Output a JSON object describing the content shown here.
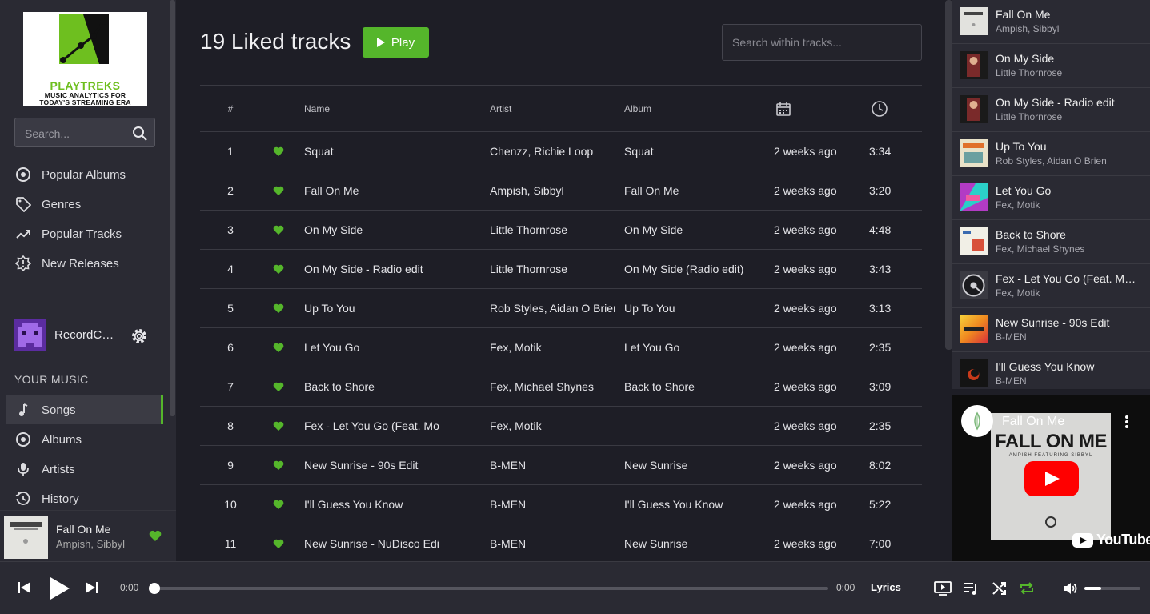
{
  "colors": {
    "accent": "#55b62b",
    "background": "#1e1e26",
    "panel": "#2a2a33",
    "youtube_red": "#ff0000"
  },
  "logo": {
    "brand": "PLAYTREKS",
    "tagline_1": "MUSIC ANALYTICS FOR",
    "tagline_2": "TODAY'S STREAMING ERA"
  },
  "sidebar": {
    "search_placeholder": "Search...",
    "browse": [
      {
        "label": "Popular Albums",
        "icon": "album-icon"
      },
      {
        "label": "Genres",
        "icon": "tag-icon"
      },
      {
        "label": "Popular Tracks",
        "icon": "trending-icon"
      },
      {
        "label": "New Releases",
        "icon": "new-releases-icon"
      }
    ],
    "profile_name": "RecordCo...",
    "section_title": "YOUR MUSIC",
    "your_music": [
      {
        "label": "Songs",
        "icon": "music-note-icon",
        "active": true
      },
      {
        "label": "Albums",
        "icon": "album-icon"
      },
      {
        "label": "Artists",
        "icon": "microphone-icon"
      },
      {
        "label": "History",
        "icon": "history-icon"
      }
    ]
  },
  "now_playing": {
    "title": "Fall On Me",
    "artist": "Ampish, Sibbyl"
  },
  "main": {
    "title": "19 Liked tracks",
    "play_label": "Play",
    "search_placeholder": "Search within tracks...",
    "columns": {
      "num": "#",
      "name": "Name",
      "artist": "Artist",
      "album": "Album",
      "date_icon": "calendar-icon",
      "duration_icon": "clock-icon"
    },
    "tracks": [
      {
        "num": "1",
        "name": "Squat",
        "artist": "Chenzz, Richie Loop",
        "album": "Squat",
        "added": "2 weeks ago",
        "duration": "3:34"
      },
      {
        "num": "2",
        "name": "Fall On Me",
        "artist": "Ampish, Sibbyl",
        "album": "Fall On Me",
        "added": "2 weeks ago",
        "duration": "3:20"
      },
      {
        "num": "3",
        "name": "On My Side",
        "artist": "Little Thornrose",
        "album": "On My Side",
        "added": "2 weeks ago",
        "duration": "4:48"
      },
      {
        "num": "4",
        "name": "On My Side - Radio edit",
        "artist": "Little Thornrose",
        "album": "On My Side (Radio edit)",
        "added": "2 weeks ago",
        "duration": "3:43"
      },
      {
        "num": "5",
        "name": "Up To You",
        "artist": "Rob Styles, Aidan O Brien",
        "album": "Up To You",
        "added": "2 weeks ago",
        "duration": "3:13"
      },
      {
        "num": "6",
        "name": "Let You Go",
        "artist": "Fex, Motik",
        "album": "Let You Go",
        "added": "2 weeks ago",
        "duration": "2:35"
      },
      {
        "num": "7",
        "name": "Back to Shore",
        "artist": "Fex, Michael Shynes",
        "album": "Back to Shore",
        "added": "2 weeks ago",
        "duration": "3:09"
      },
      {
        "num": "8",
        "name": "Fex - Let You Go (Feat. Mot",
        "artist": "Fex, Motik",
        "album": "",
        "added": "2 weeks ago",
        "duration": "2:35"
      },
      {
        "num": "9",
        "name": "New Sunrise - 90s Edit",
        "artist": "B-MEN",
        "album": "New Sunrise",
        "added": "2 weeks ago",
        "duration": "8:02"
      },
      {
        "num": "10",
        "name": "I'll Guess You Know",
        "artist": "B-MEN",
        "album": "I'll Guess You Know",
        "added": "2 weeks ago",
        "duration": "5:22"
      },
      {
        "num": "11",
        "name": "New Sunrise - NuDisco Edit",
        "artist": "B-MEN",
        "album": "New Sunrise",
        "added": "2 weeks ago",
        "duration": "7:00"
      }
    ]
  },
  "queue": [
    {
      "title": "Fall On Me",
      "artist": "Ampish, Sibbyl",
      "thumb": "#e2e2de"
    },
    {
      "title": "On My Side",
      "artist": "Little Thornrose",
      "thumb": "#7a2a2a"
    },
    {
      "title": "On My Side - Radio edit",
      "artist": "Little Thornrose",
      "thumb": "#7a2a2a"
    },
    {
      "title": "Up To You",
      "artist": "Rob Styles, Aidan O Brien",
      "thumb": "#e9e2c8"
    },
    {
      "title": "Let You Go",
      "artist": "Fex, Motik",
      "thumb": "#b23bc4"
    },
    {
      "title": "Back to Shore",
      "artist": "Fex, Michael Shynes",
      "thumb": "#f1efe6"
    },
    {
      "title": "Fex - Let You Go (Feat. Motik)",
      "artist": "Fex, Motik",
      "thumb": "#3a3a42"
    },
    {
      "title": "New Sunrise - 90s Edit",
      "artist": "B-MEN",
      "thumb": "#f0a81e"
    },
    {
      "title": "I'll Guess You Know",
      "artist": "B-MEN",
      "thumb": "#141414"
    }
  ],
  "video": {
    "title": "Fall On Me",
    "art_title": "FALL ON ME",
    "art_subtitle": "AMPISH FEATURING SIBBYL",
    "provider": "YouTube"
  },
  "player": {
    "current_time": "0:00",
    "total_time": "0:00",
    "lyrics_label": "Lyrics",
    "progress": 0,
    "volume": 0.3
  }
}
